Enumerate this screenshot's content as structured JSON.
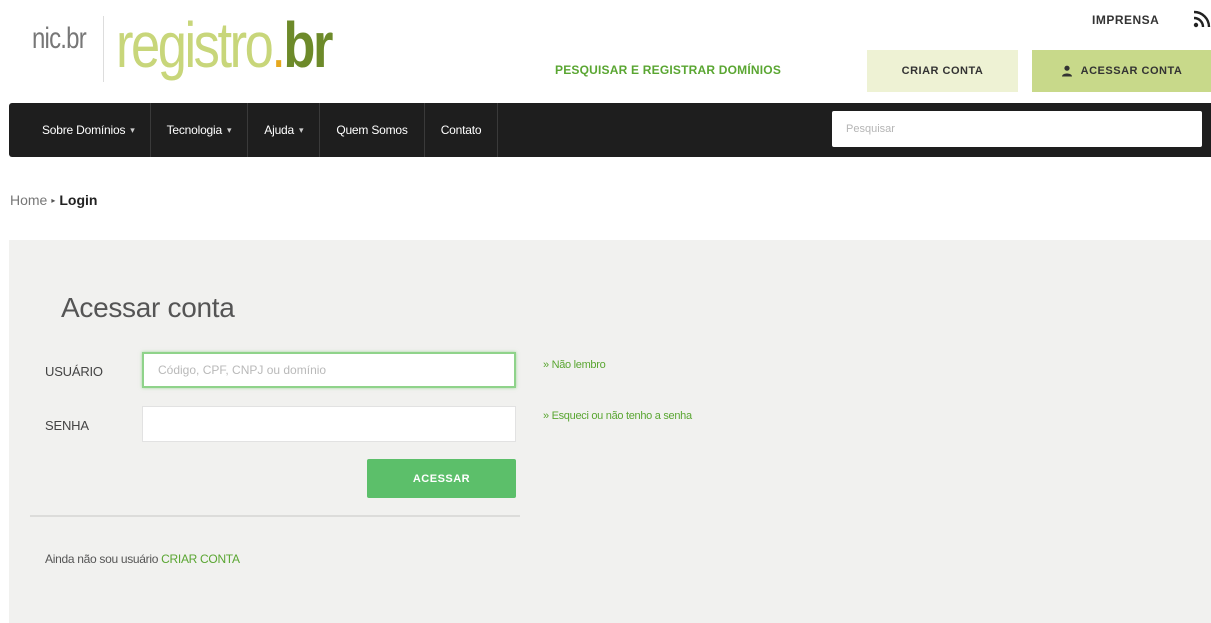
{
  "header": {
    "logo_nic": "nic.br",
    "logo_registro": "registro",
    "logo_dot": ".",
    "logo_br": "br",
    "imprensa": "IMPRENSA",
    "pesquisar_link": "PESQUISAR E REGISTRAR DOMÍNIOS",
    "criar_conta": "CRIAR CONTA",
    "acessar_conta": "ACESSAR CONTA"
  },
  "navbar": {
    "items": [
      {
        "label": "Sobre Domínios",
        "caret": "▾"
      },
      {
        "label": "Tecnologia",
        "caret": "▾"
      },
      {
        "label": "Ajuda",
        "caret": "▾"
      },
      {
        "label": "Quem Somos"
      },
      {
        "label": "Contato"
      }
    ],
    "search_placeholder": "Pesquisar"
  },
  "breadcrumb": {
    "home": "Home",
    "separator": "▸",
    "current": "Login"
  },
  "login": {
    "title": "Acessar conta",
    "user_label": "USUÁRIO",
    "user_placeholder": "Código, CPF, CNPJ ou domínio",
    "user_value": "",
    "pass_label": "SENHA",
    "pass_value": "",
    "forgot_user": "» Não lembro",
    "forgot_pass": "» Esqueci ou não tenho a senha",
    "submit": "ACESSAR",
    "signup_text": "Ainda não sou usuário",
    "signup_link": "CRIAR CONTA"
  },
  "colors": {
    "accent_green": "#5aa632",
    "button_green": "#5cbf6a",
    "logo_light": "#c8d67a",
    "logo_dark": "#6d8a2a",
    "logo_dot": "#e6a81e",
    "navbar": "#1e1e1e",
    "panel": "#f1f1ef"
  },
  "icons": {
    "rss": "rss-icon",
    "user": "user-icon"
  }
}
